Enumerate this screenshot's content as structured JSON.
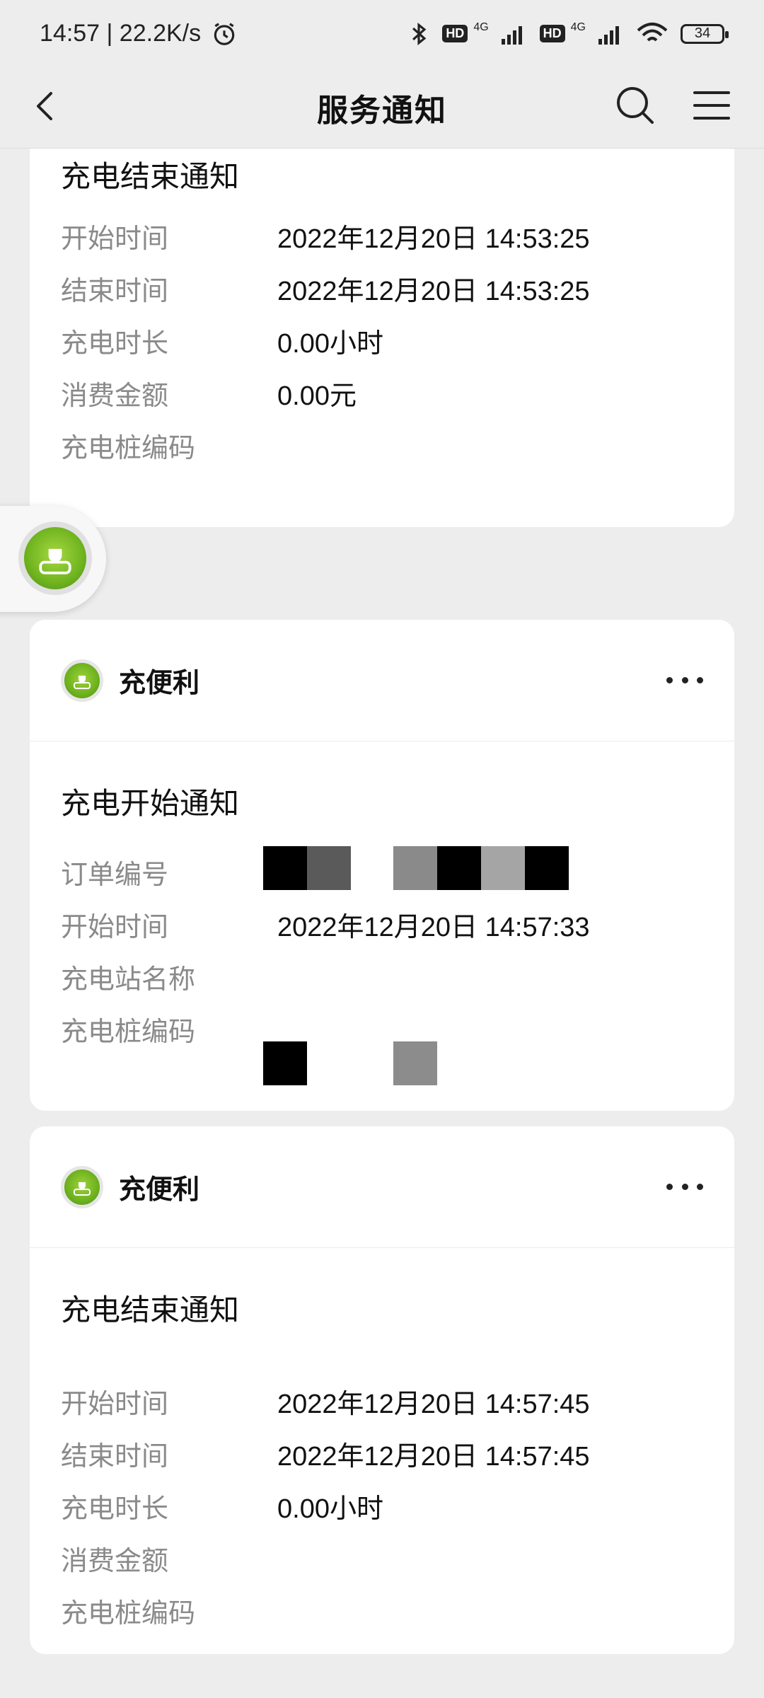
{
  "status_bar": {
    "time": "14:57 | 22.2K/s",
    "hd1": "HD",
    "hd2": "HD",
    "net1": "4G",
    "net2": "4G",
    "battery": "34"
  },
  "nav": {
    "title": "服务通知"
  },
  "cards": [
    {
      "title": "充电结束通知",
      "rows": [
        {
          "label": "开始时间",
          "value": "2022年12月20日 14:53:25"
        },
        {
          "label": "结束时间",
          "value": "2022年12月20日 14:53:25"
        },
        {
          "label": "充电时长",
          "value": "0.00小时"
        },
        {
          "label": "消费金额",
          "value": "0.00元"
        },
        {
          "label": "充电桩编码",
          "value": ""
        }
      ]
    },
    {
      "sender": "充便利",
      "title": "充电开始通知",
      "rows": [
        {
          "label": "订单编号",
          "value": ""
        },
        {
          "label": "开始时间",
          "value": "2022年12月20日 14:57:33"
        },
        {
          "label": "充电站名称",
          "value": ""
        },
        {
          "label": "充电桩编码",
          "value": ""
        }
      ]
    },
    {
      "sender": "充便利",
      "title": "充电结束通知",
      "rows": [
        {
          "label": "开始时间",
          "value": "2022年12月20日 14:57:45"
        },
        {
          "label": "结束时间",
          "value": "2022年12月20日 14:57:45"
        },
        {
          "label": "充电时长",
          "value": "0.00小时"
        },
        {
          "label": "消费金额",
          "value": ""
        },
        {
          "label": "充电桩编码",
          "value": ""
        }
      ]
    }
  ],
  "colors": {
    "brand_green": "#6cb11e",
    "label_gray": "#8a8a8a",
    "background": "#ededed"
  }
}
